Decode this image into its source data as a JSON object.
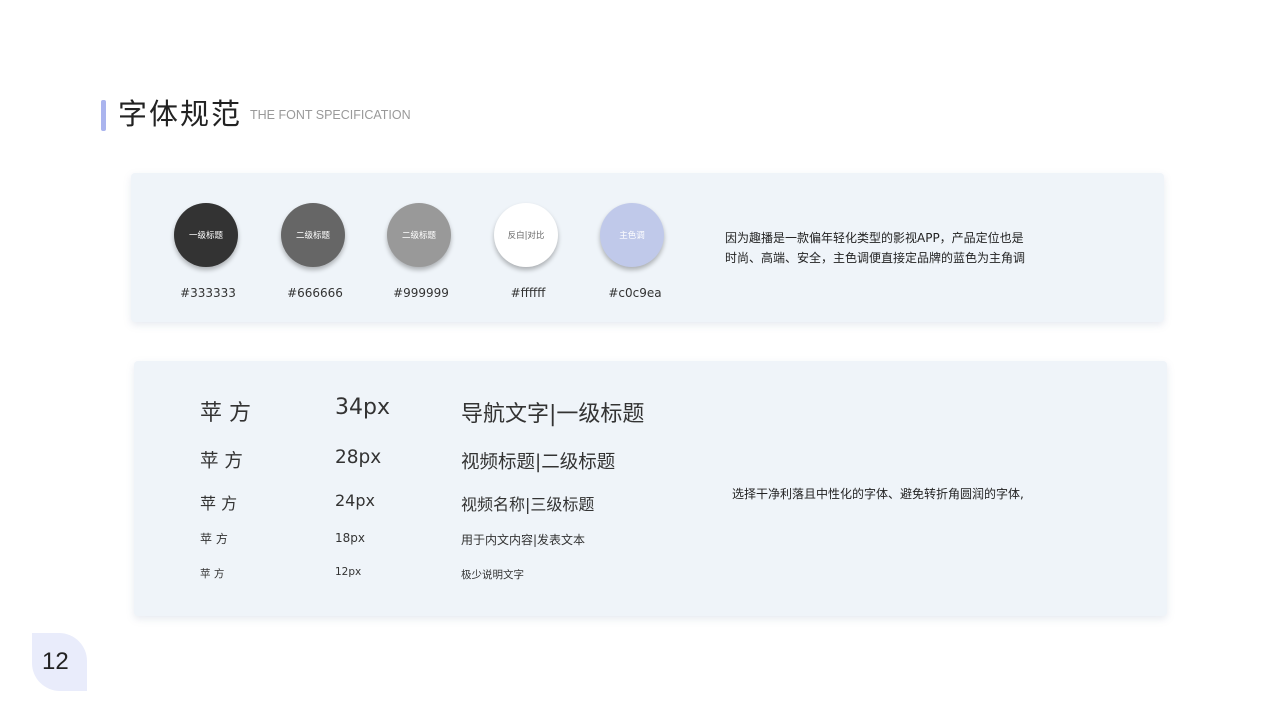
{
  "header": {
    "title": "字体规范",
    "subtitle": "THE FONT SPECIFICATION"
  },
  "palette": {
    "swatches": [
      {
        "label": "一级标题",
        "hex": "#333333",
        "color": "#333333",
        "text_color": "#ffffff"
      },
      {
        "label": "二级标题",
        "hex": "#666666",
        "color": "#666666",
        "text_color": "#ffffff"
      },
      {
        "label": "二级标题",
        "hex": "#999999",
        "color": "#999999",
        "text_color": "#ffffff"
      },
      {
        "label": "反白|对比",
        "hex": "#ffffff",
        "color": "#ffffff",
        "text_color": "#666666"
      },
      {
        "label": "主色调",
        "hex": "#c0c9ea",
        "color": "#c0c9ea",
        "text_color": "#ffffff"
      }
    ],
    "description_line1": "因为趣播是一款偏年轻化类型的影视APP，产品定位也是",
    "description_line2": "时尚、高端、安全，主色调便直接定品牌的蓝色为主角调"
  },
  "typography": {
    "rows": [
      {
        "font": "苹 方",
        "size": "34px",
        "usage": "导航文字|一级标题"
      },
      {
        "font": "苹 方",
        "size": "28px",
        "usage": "视频标题|二级标题"
      },
      {
        "font": "苹 方",
        "size": "24px",
        "usage": "视频名称|三级标题"
      },
      {
        "font": "苹 方",
        "size": "18px",
        "usage": "用于内文内容|发表文本"
      },
      {
        "font": "苹 方",
        "size": "12px",
        "usage": "极少说明文字"
      }
    ],
    "description": "选择干净利落且中性化的字体、避免转折角圆润的字体,"
  },
  "page": {
    "number": "12"
  },
  "colors": {
    "accent": "#aab4ee",
    "card_background": "#eff4f9",
    "page_badge": "#e9ecfb"
  }
}
